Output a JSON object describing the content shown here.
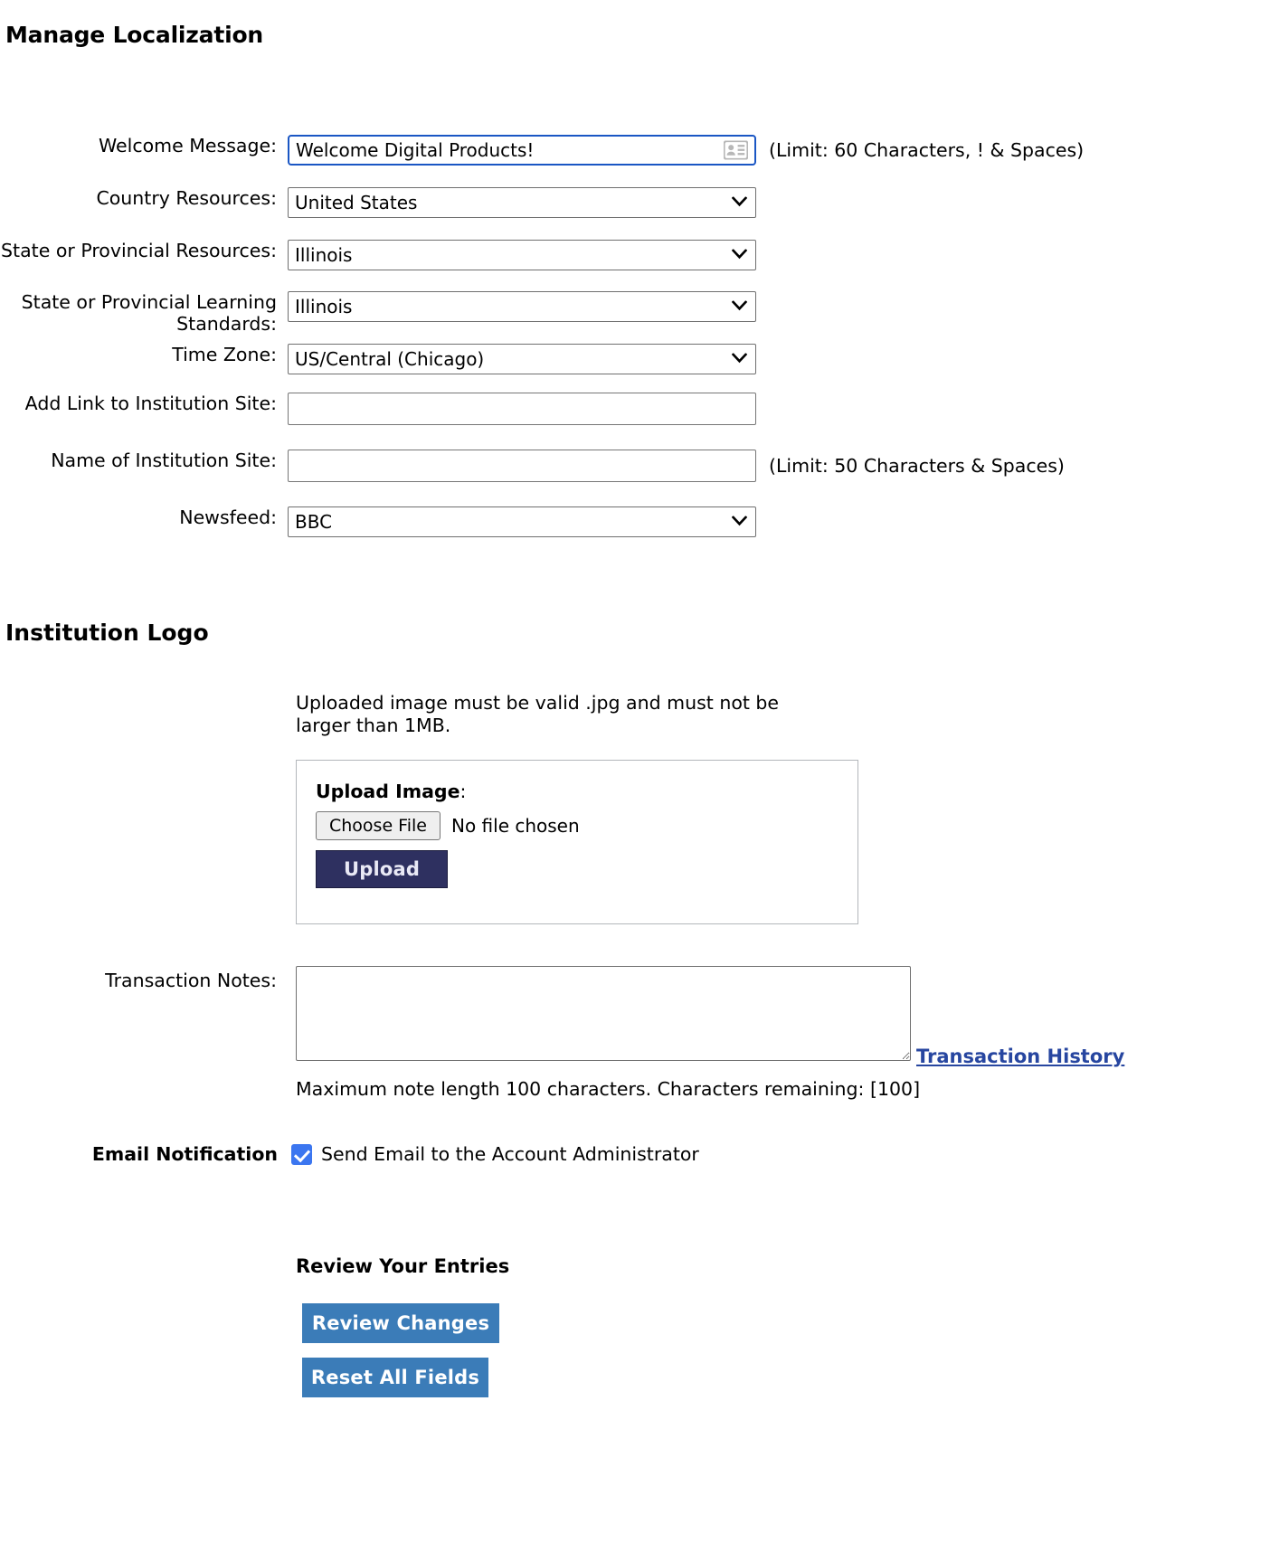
{
  "page": {
    "title": "Manage Localization",
    "logo_section_title": "Institution Logo"
  },
  "form": {
    "welcome_message": {
      "label": "Welcome Message:",
      "value": "Welcome Digital Products!",
      "placeholder": "",
      "hint": "(Limit: 60 Characters, ! & Spaces)",
      "icon": "contact-card-icon"
    },
    "country_resources": {
      "label": "Country Resources:",
      "value": "United States",
      "options": [
        "United States"
      ]
    },
    "state_resources": {
      "label": "State or Provincial Resources:",
      "value": "Illinois",
      "options": [
        "Illinois"
      ]
    },
    "state_learning_standards": {
      "label": "State or Provincial Learning Standards:",
      "value": "Illinois",
      "options": [
        "Illinois"
      ]
    },
    "time_zone": {
      "label": "Time Zone:",
      "value": "US/Central (Chicago)",
      "options": [
        "US/Central (Chicago)"
      ]
    },
    "institution_link": {
      "label": "Add Link to Institution Site:",
      "value": "",
      "placeholder": ""
    },
    "institution_name": {
      "label": "Name of Institution Site:",
      "value": "",
      "placeholder": "",
      "hint": "(Limit: 50 Characters & Spaces)"
    },
    "newsfeed": {
      "label": "Newsfeed:",
      "value": "BBC",
      "options": [
        "BBC"
      ]
    }
  },
  "logo": {
    "note": "Uploaded image must be valid .jpg and must not be larger than 1MB.",
    "upload_title": "Upload Image",
    "upload_title_colon": ":",
    "choose_file_label": "Choose File",
    "no_file_text": "No file chosen",
    "upload_button_label": "Upload"
  },
  "notes": {
    "label": "Transaction Notes:",
    "value": "",
    "placeholder": "",
    "history_link": "Transaction History",
    "limit_text": "Maximum note length 100 characters. Characters remaining: [100]"
  },
  "email_notification": {
    "label": "Email Notification",
    "checkbox_text": "Send Email to the Account Administrator",
    "checked": true
  },
  "review": {
    "title": "Review Your Entries",
    "review_button_label": "Review Changes",
    "reset_button_label": "Reset All Fields"
  },
  "colors": {
    "focus_border": "#1a56c4",
    "upload_button_bg": "#2e3060",
    "action_button_bg": "#3b7cb8",
    "link": "#2746a0",
    "checkbox": "#3b76f0"
  }
}
